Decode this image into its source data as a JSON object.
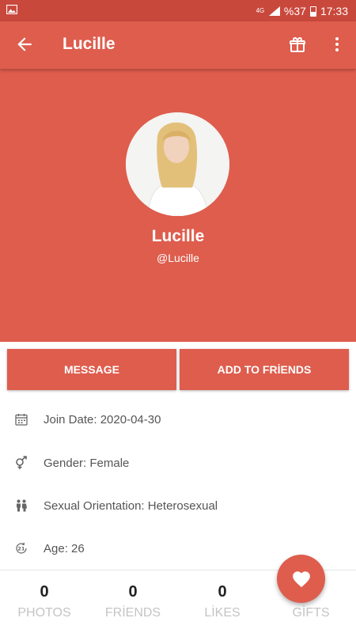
{
  "status_bar": {
    "network": "4G",
    "battery": "%37",
    "time": "17:33"
  },
  "app_bar": {
    "title": "Lucille"
  },
  "profile": {
    "name": "Lucille",
    "handle": "@Lucille"
  },
  "actions": {
    "message_label": "MESSAGE",
    "add_friends_label": "ADD TO FRİENDS"
  },
  "info": [
    {
      "icon": "calendar-icon",
      "text": "Join Date: 2020-04-30"
    },
    {
      "icon": "gender-icon",
      "text": "Gender: Female"
    },
    {
      "icon": "people-icon",
      "text": "Sexual Orientation: Heterosexual"
    },
    {
      "icon": "age-21-icon",
      "text": "Age: 26"
    }
  ],
  "stats": [
    {
      "count": "0",
      "label": "PHOTOS"
    },
    {
      "count": "0",
      "label": "FRİENDS"
    },
    {
      "count": "0",
      "label": "LİKES"
    },
    {
      "count": "",
      "label": "GİFTS"
    }
  ],
  "colors": {
    "primary": "#de5d4d",
    "status_bar": "#c9483c"
  }
}
